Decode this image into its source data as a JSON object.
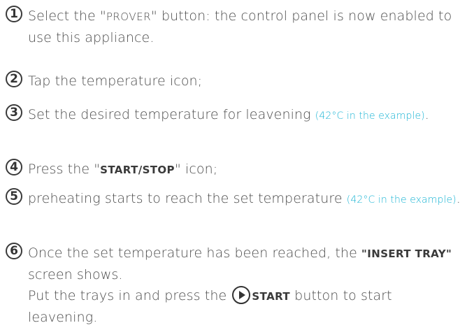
{
  "steps": [
    {
      "number": "1",
      "text_a": "Select the \"",
      "prover": "PROVER",
      "text_b": "\" button: the control panel is now enabled to use this appliance."
    },
    {
      "number": "2",
      "text": "Tap the temperature icon;"
    },
    {
      "number": "3",
      "text": "Set the desired temperature for leavening ",
      "note": "(42°C in the example)",
      "tail": "."
    },
    {
      "number": "4",
      "text_a": "Press the \"",
      "strong": "START/STOP",
      "text_b": "\" icon;"
    },
    {
      "number": "5",
      "text": "preheating starts to reach the set temperature ",
      "note": "(42°C in the example)",
      "tail": "."
    },
    {
      "number": "6",
      "text_a": "Once the set temperature has been reached, the ",
      "strong_a": "\"INSERT TRAY\"",
      "text_b": " screen shows.",
      "text_c": "Put the trays in and press the ",
      "strong_b": "START",
      "text_d": " button to start leavening."
    }
  ],
  "icons": {
    "play": "play-button-icon"
  }
}
